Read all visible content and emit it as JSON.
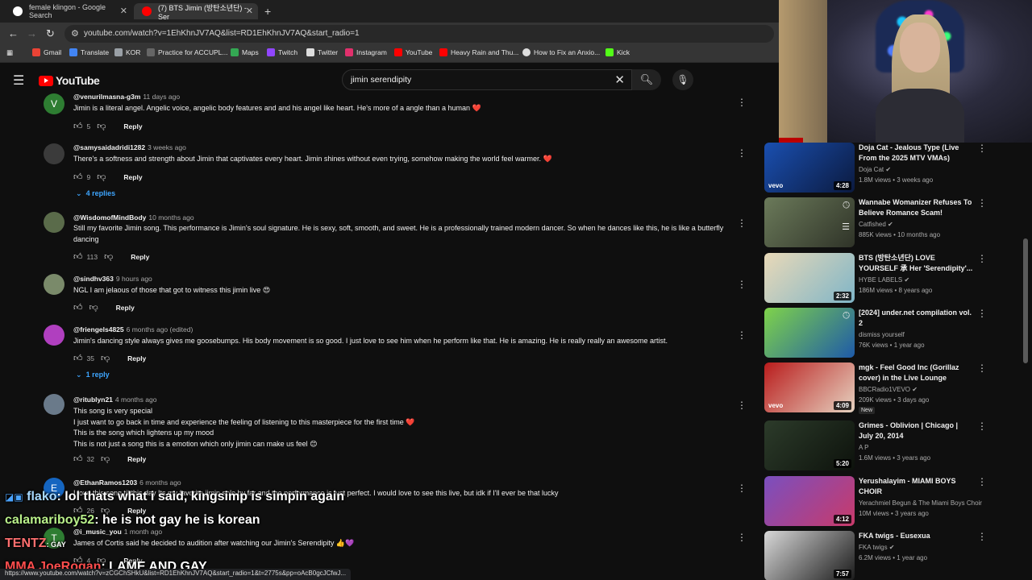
{
  "browser": {
    "tabs": [
      {
        "label": "female klingon - Google Search",
        "favicon_color": "#ffffff"
      },
      {
        "label": "(7) BTS Jimin (방탄소년단) - Ser",
        "favicon_color": "#ff0000"
      }
    ],
    "url": "youtube.com/watch?v=1EhKhnJV7AQ&list=RD1EhKhnJV7AQ&start_radio=1",
    "bookmarks": [
      {
        "label": "Gmail",
        "color": "#ea4335"
      },
      {
        "label": "Translate",
        "color": "#4285f4"
      },
      {
        "label": "KOR",
        "color": "#9aa0a6"
      },
      {
        "label": "Practice for ACCUPL...",
        "color": "#666666"
      },
      {
        "label": "Maps",
        "color": "#34a853"
      },
      {
        "label": "Twitch",
        "color": "#9146ff"
      },
      {
        "label": "Twitter",
        "color": "#dddddd"
      },
      {
        "label": "Instagram",
        "color": "#e1306c"
      },
      {
        "label": "YouTube",
        "color": "#ff0000"
      },
      {
        "label": "Heavy Rain and Thu...",
        "color": "#ff0000"
      },
      {
        "label": "How to Fix an Anxio...",
        "color": "#dddddd"
      },
      {
        "label": "Kick",
        "color": "#53fc18"
      }
    ],
    "status_url": "https://www.youtube.com/watch?v=zCGChSHkU&list=RD1EhKhnJV7AQ&start_radio=1&t=2775s&pp=oAcB0gcJCfwJ..."
  },
  "youtube": {
    "logo_text": "YouTube",
    "search_query": "jimin serendipity"
  },
  "comments": [
    {
      "avatar": "V",
      "avatar_color": "#2e7d32",
      "author": "@venurilmasna-g3m",
      "ago": "11 days ago",
      "text": "Jimin is a literal angel. Angelic voice, angelic body features and and his angel like heart. He's more of a angle than a human",
      "emoji": "❤️",
      "likes": "5",
      "reply": "Reply"
    },
    {
      "avatar": "",
      "avatar_color": "#3b3b3b",
      "author": "@samysaidadridi1282",
      "ago": "3 weeks ago",
      "text": "There's a softness and strength about Jimin that captivates every heart. Jimin shines without even trying, somehow making the world feel warmer.",
      "emoji": "❤️",
      "likes": "9",
      "reply": "Reply",
      "replies": "4 replies"
    },
    {
      "avatar": "",
      "avatar_color": "#5a6b4a",
      "author": "@WisdomofMindBody",
      "ago": "10 months ago",
      "text": "Still my favorite Jimin song. This performance is Jimin's soul signature. He is sexy, soft, smooth, and sweet. He is a professionally trained modern dancer. So when he dances like this, he is like a butterfly dancing",
      "emoji": "",
      "likes": "113",
      "reply": "Reply"
    },
    {
      "avatar": "",
      "avatar_color": "#7a8a6a",
      "author": "@sindhv363",
      "ago": "9 hours ago",
      "text": "NGL I am jelaous of those that got to witness this jimin live",
      "emoji": "😍",
      "likes": "",
      "reply": "Reply"
    },
    {
      "avatar": "",
      "avatar_color": "#b03fbf",
      "author": "@friengels4825",
      "ago": "6 months ago (edited)",
      "text": "Jimin's dancing style always gives me goosebumps. His body movement is so good. I just love to see him when he perform like that. He is amazing. He is really really an awesome artist.",
      "emoji": "",
      "likes": "35",
      "reply": "Reply",
      "replies": "1 reply"
    },
    {
      "avatar": "",
      "avatar_color": "#6a7a8a",
      "author": "@ritublyn21",
      "ago": "4 months ago",
      "lines": [
        "This song is very special",
        "I just want to go back in time and experience the feeling of listening to this masterpiece for the first time ❤️",
        "This is the song which lightens up my mood",
        "This is not just a song this is a emotion which only jimin can make us feel 😊"
      ],
      "likes": "32",
      "reply": "Reply"
    },
    {
      "avatar": "E",
      "avatar_color": "#1565c0",
      "author": "@EthanRamos1203",
      "ago": "6 months ago",
      "text": "I love this song til this day Its my favorite jimin solo by far and the performance is just perfect. I would love to see this live, but idk if I'll ever be that lucky",
      "emoji": "",
      "likes": "26",
      "reply": "Reply"
    },
    {
      "avatar": "T",
      "avatar_color": "#2e7d32",
      "author": "@i_music_you",
      "ago": "1 month ago",
      "text": "James of Cortis said he decided to audition after watching our Jimin's Serendipity",
      "emoji": "👍💜",
      "likes": "4",
      "reply": "Reply"
    }
  ],
  "sidebar": [
    {
      "title": "Doja Cat - Jealous Type (Live From the 2025 MTV VMAs)",
      "channel": "Doja Cat ✔",
      "stats": "1.8M views • 3 weeks ago",
      "duration": "4:28",
      "vevo": "vevo",
      "color1": "#1a4fb0",
      "color2": "#0b1a3f"
    },
    {
      "title": "Wannabe Womanizer Refuses To Believe Romance Scam!",
      "channel": "Catfished ✔",
      "stats": "885K views • 10 months ago",
      "duration": "",
      "vevo": "",
      "color1": "#6b7a5a",
      "color2": "#2f3328"
    },
    {
      "title": "BTS (방탄소년단) LOVE YOURSELF 承 Her 'Serendipity'...",
      "channel": "HYBE LABELS ✔",
      "stats": "186M views • 8 years ago",
      "duration": "2:32",
      "vevo": "",
      "color1": "#e9d9b8",
      "color2": "#7fb5c7"
    },
    {
      "title": "[2024] under.net compilation vol. 2",
      "channel": "dismiss yourself",
      "stats": "76K views • 1 year ago",
      "duration": "",
      "vevo": "",
      "color1": "#7fd34a",
      "color2": "#1e5aa8"
    },
    {
      "title": "mgk - Feel Good Inc (Gorillaz cover) in the Live Lounge",
      "channel": "BBCRadio1VEVO ✔",
      "stats": "209K views • 3 days ago",
      "duration": "4:09",
      "vevo": "vevo",
      "color1": "#b91c1c",
      "color2": "#e6d2c0",
      "badge": "New"
    },
    {
      "title": "Grimes - Oblivion | Chicago | July 20, 2014",
      "channel": "A P",
      "stats": "1.6M views • 3 years ago",
      "duration": "5:20",
      "vevo": "",
      "color1": "#2c3b2a",
      "color2": "#0d120c"
    },
    {
      "title": "Yerushalayim - MIAMI BOYS CHOIR",
      "channel": "Yerachmiel Begun & The Miami Boys Choir",
      "stats": "10M views • 3 years ago",
      "duration": "4:12",
      "vevo": "",
      "color1": "#7a4fbf",
      "color2": "#c93a6a"
    },
    {
      "title": "FKA twigs - Eusexua",
      "channel": "FKA twigs ✔",
      "stats": "6.2M views • 1 year ago",
      "duration": "7:57",
      "vevo": "",
      "color1": "#d8d8d8",
      "color2": "#1a1a1a"
    }
  ],
  "chat": [
    {
      "user": "flako",
      "msg": ": lol thats what i said, kingsimp is simpin again"
    },
    {
      "user": "calamariboy52",
      "msg": ": he is not gay he is korean"
    },
    {
      "user": "TENTZ",
      "msg": ": GAY"
    },
    {
      "user": "MMA JoeRogan",
      "msg": ": LAME AND GAY"
    }
  ]
}
